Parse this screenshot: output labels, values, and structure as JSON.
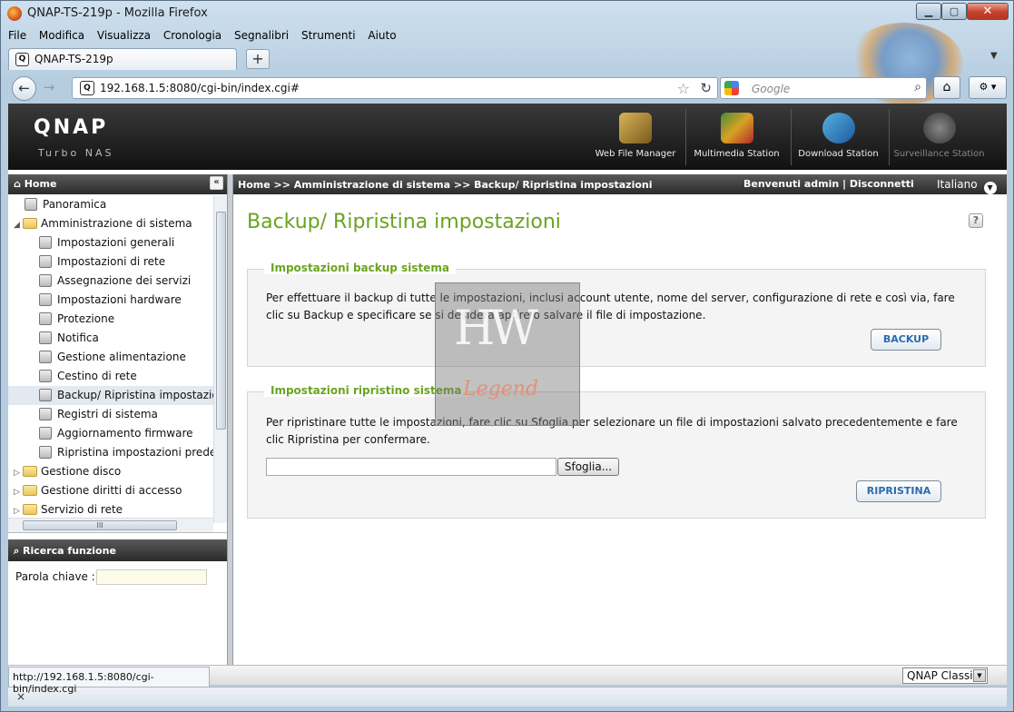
{
  "window": {
    "title": "QNAP-TS-219p - Mozilla Firefox"
  },
  "menu": [
    "File",
    "Modifica",
    "Visualizza",
    "Cronologia",
    "Segnalibri",
    "Strumenti",
    "Aiuto"
  ],
  "tab": {
    "label": "QNAP-TS-219p"
  },
  "address": {
    "url": "192.168.1.5:8080/cgi-bin/index.cgi#"
  },
  "search": {
    "placeholder": "Google"
  },
  "qnap": {
    "logo": "QNAP",
    "subtitle": "Turbo NAS",
    "apps": [
      "Web File Manager",
      "Multimedia Station",
      "Download Station",
      "Surveillance Station"
    ]
  },
  "sidebar": {
    "home_label": "Home",
    "items": [
      {
        "label": "Panoramica"
      },
      {
        "label": "Amministrazione di sistema"
      },
      {
        "label": "Impostazioni generali"
      },
      {
        "label": "Impostazioni di rete"
      },
      {
        "label": "Assegnazione dei servizi"
      },
      {
        "label": "Impostazioni hardware"
      },
      {
        "label": "Protezione"
      },
      {
        "label": "Notifica"
      },
      {
        "label": "Gestione alimentazione"
      },
      {
        "label": "Cestino di rete"
      },
      {
        "label": "Backup/ Ripristina impostazioni"
      },
      {
        "label": "Registri di sistema"
      },
      {
        "label": "Aggiornamento firmware"
      },
      {
        "label": "Ripristina impostazioni predefinite"
      },
      {
        "label": "Gestione disco"
      },
      {
        "label": "Gestione diritti di accesso"
      },
      {
        "label": "Servizio di rete"
      }
    ],
    "hscroll_label": "III"
  },
  "find": {
    "title": "Ricerca funzione",
    "keyword_label": "Parola chiave :"
  },
  "header": {
    "breadcrumb": "Home >> Amministrazione di sistema >> Backup/ Ripristina impostazioni",
    "welcome": "Benvenuti admin | Disconnetti",
    "language": "Italiano"
  },
  "page": {
    "title": "Backup/ Ripristina impostazioni",
    "help": "?",
    "backup": {
      "legend": "Impostazioni backup sistema",
      "description": "Per effettuare il backup di tutte le impostazioni, inclusi account utente, nome del server, configurazione di rete e così via, fare clic su Backup e specificare se si desidera aprire o salvare il file di impostazione.",
      "button": "BACKUP"
    },
    "restore": {
      "legend": "Impostazioni ripristino sistema",
      "description": "Per ripristinare tutte le impostazioni, fare clic su Sfoglia per selezionare un file di impostazioni salvato precedentemente e fare clic Ripristina per confermare.",
      "browse": "Sfoglia...",
      "button": "RIPRISTINA"
    }
  },
  "watermark": {
    "line1": "HW",
    "line2": "Legend"
  },
  "footer": {
    "skin": "QNAP Classic"
  },
  "status": {
    "url": "http://192.168.1.5:8080/cgi-bin/index.cgi",
    "close": "×"
  }
}
